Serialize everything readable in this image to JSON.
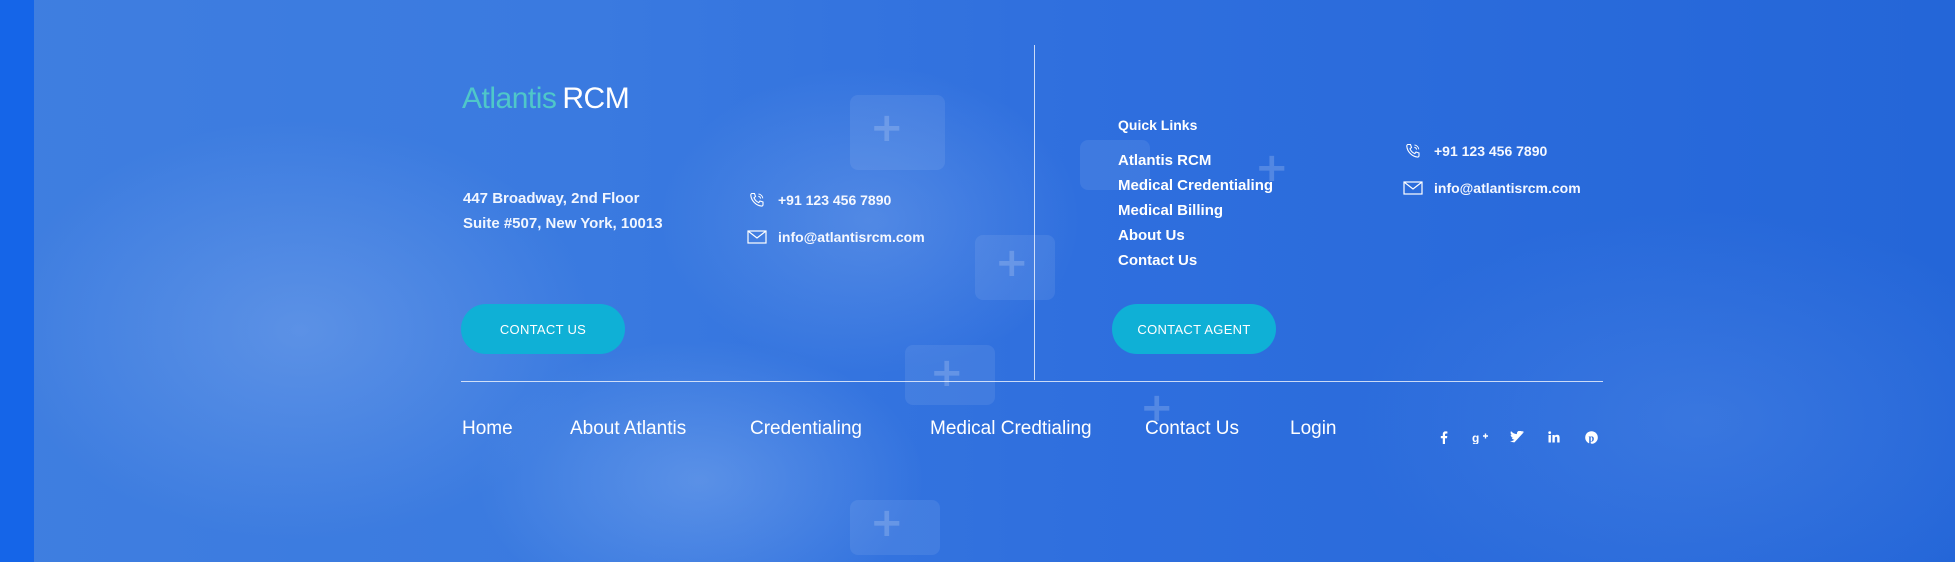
{
  "brand": {
    "part1": "Atlantis",
    "part2": "RCM"
  },
  "left_block": {
    "address_line1": "447 Broadway, 2nd Floor",
    "address_line2": "Suite #507, New York, 10013",
    "phone": "+91 123 456 7890",
    "email": "info@atlantisrcm.com",
    "button_label": "CONTACT US"
  },
  "quick_links": {
    "title": "Quick Links",
    "items": [
      "Atlantis RCM",
      "Medical Credentialing",
      "Medical Billing",
      "About Us",
      "Contact Us"
    ],
    "button_label": "CONTACT AGENT"
  },
  "right_contact": {
    "phone": "+91 123 456 7890",
    "email": "info@atlantisrcm.com"
  },
  "bottom_nav": [
    "Home",
    "About Atlantis",
    "Credentialing",
    "Medical Credtialing",
    "Contact Us",
    "Login"
  ],
  "social_icons": [
    "facebook-icon",
    "google-plus-icon",
    "twitter-icon",
    "linkedin-icon",
    "pinterest-icon"
  ],
  "colors": {
    "background": "#2a6ad8",
    "brand_accent": "#4fc7c9",
    "button": "#0fb0d6",
    "left_bar": "#1565e8"
  }
}
